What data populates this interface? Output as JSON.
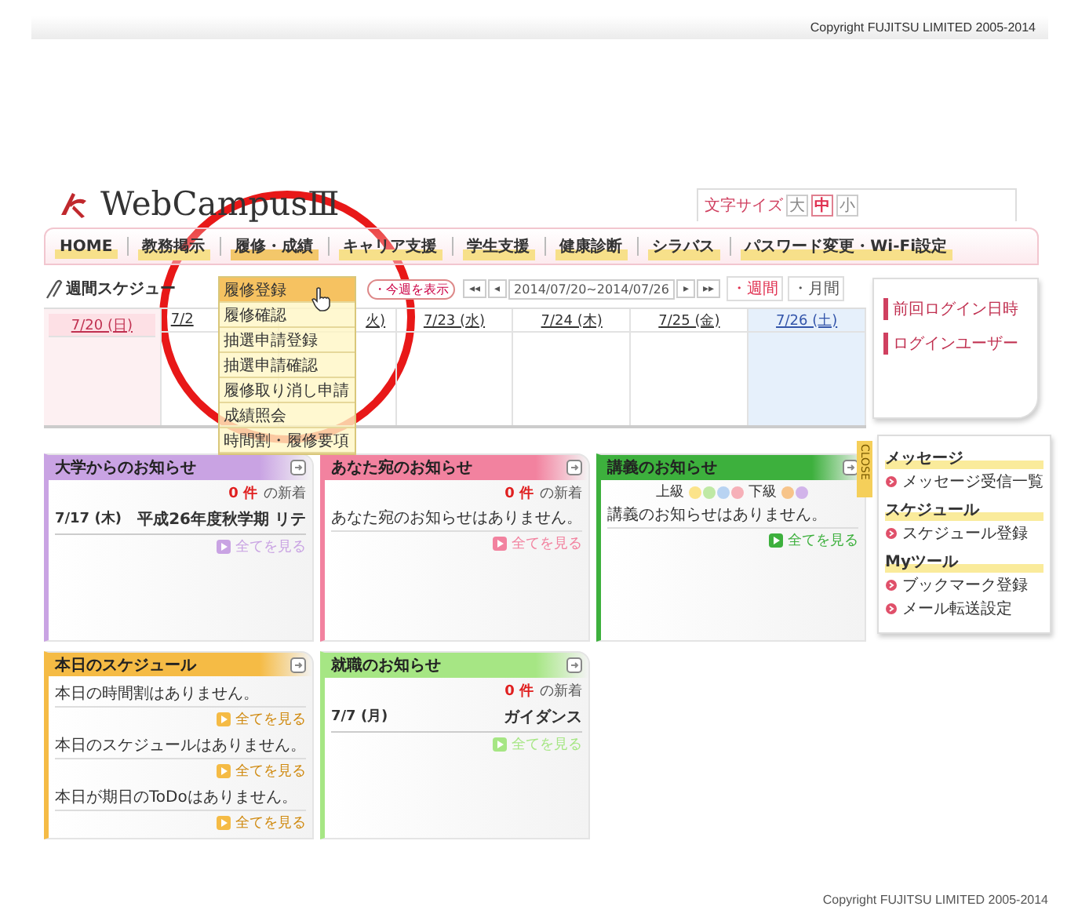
{
  "copyright_top": "Copyright FUJITSU LIMITED 2005-2014",
  "header": {
    "logo": "WebCampusⅢ",
    "font_size_label": "文字サイズ",
    "font_sizes": [
      {
        "label": "大",
        "selected": false
      },
      {
        "label": "中",
        "selected": true
      },
      {
        "label": "小",
        "selected": false
      }
    ]
  },
  "nav": [
    {
      "label": "HOME",
      "expanded": false
    },
    {
      "label": "教務掲示",
      "expanded": false
    },
    {
      "label": "履修・成績",
      "expanded": true
    },
    {
      "label": "キャリア支援",
      "expanded": false
    },
    {
      "label": "学生支援",
      "expanded": false
    },
    {
      "label": "健康診断",
      "expanded": false
    },
    {
      "label": "シラバス",
      "expanded": false
    },
    {
      "label": "パスワード変更・Wi-Fi設定",
      "expanded": false
    }
  ],
  "dropdown": [
    {
      "label": "履修登録",
      "selected": true
    },
    {
      "label": "履修確認",
      "selected": false
    },
    {
      "label": "抽選申請登録",
      "selected": false
    },
    {
      "label": "抽選申請確認",
      "selected": false
    },
    {
      "label": "履修取り消し申請",
      "selected": false
    },
    {
      "label": "成績照会",
      "selected": false
    },
    {
      "label": "時間割・履修要項",
      "selected": false
    }
  ],
  "schedule": {
    "title": "週間スケジュー",
    "today_button": "・今週を表示",
    "prev": [
      "◂◂",
      "◂"
    ],
    "range": "2014/07/20~2014/07/26",
    "next": [
      "▸",
      "▸▸"
    ],
    "views": [
      {
        "label": "・週間",
        "selected": true
      },
      {
        "label": "・月間",
        "selected": false
      }
    ],
    "days": [
      {
        "label": "7/20 (日)",
        "kind": "sunday"
      },
      {
        "label": "7/2",
        "kind": "cut_end"
      },
      {
        "label": "火)",
        "kind": "cut_start"
      },
      {
        "label": "7/23 (水)",
        "kind": "weekday"
      },
      {
        "label": "7/24 (木)",
        "kind": "weekday"
      },
      {
        "label": "7/25 (金)",
        "kind": "weekday"
      },
      {
        "label": "7/26 (土)",
        "kind": "saturday"
      }
    ]
  },
  "login_panel": [
    "前回ログイン日時",
    "ログインユーザー"
  ],
  "side_tab": "CLOSE",
  "side_menu": [
    {
      "heading": "メッセージ",
      "links": [
        "メッセージ受信一覧"
      ]
    },
    {
      "heading": "スケジュール",
      "links": [
        "スケジュール登録"
      ]
    },
    {
      "heading": "Myツール",
      "links": [
        "ブックマーク登録",
        "メール転送設定"
      ]
    }
  ],
  "cards": [
    {
      "title": "大学からのお知らせ",
      "color": "#c9a3e3",
      "items": [
        {
          "kind": "count",
          "number": "0 件",
          "label": "の新着"
        },
        {
          "kind": "news",
          "date": "7/17 (木)",
          "title": "平成26年度秋学期 リテ"
        },
        {
          "kind": "more",
          "label": "全てを見る"
        }
      ]
    },
    {
      "title": "あなた宛のお知らせ",
      "color": "#f2829f",
      "items": [
        {
          "kind": "count",
          "number": "0 件",
          "label": "の新着"
        },
        {
          "kind": "message",
          "text": "あなた宛のお知らせはありません。"
        },
        {
          "kind": "more",
          "label": "全てを見る"
        }
      ]
    },
    {
      "title": "講義のお知らせ",
      "color": "#3db03d",
      "items": [
        {
          "kind": "levels",
          "upper": "上級",
          "lower": "下級"
        },
        {
          "kind": "message",
          "text": "講義のお知らせはありません。"
        },
        {
          "kind": "more",
          "label": "全てを見る"
        }
      ]
    },
    {
      "title": "本日のスケジュール",
      "color": "#f5bb45",
      "items": [
        {
          "kind": "message",
          "text": "本日の時間割はありません。"
        },
        {
          "kind": "more",
          "label": "全てを見る"
        },
        {
          "kind": "message",
          "text": "本日のスケジュールはありません。"
        },
        {
          "kind": "more",
          "label": "全てを見る"
        },
        {
          "kind": "message",
          "text": "本日が期日のToDoはありません。"
        },
        {
          "kind": "more",
          "label": "全てを見る"
        }
      ]
    },
    {
      "title": "就職のお知らせ",
      "color": "#a6e684",
      "items": [
        {
          "kind": "count",
          "number": "0 件",
          "label": "の新着"
        },
        {
          "kind": "news",
          "date": "7/7 (月)",
          "title": "ガイダンス"
        },
        {
          "kind": "more",
          "label": "全てを見る"
        }
      ]
    }
  ],
  "copyright_bottom": "Copyright FUJITSU LIMITED 2005-2014"
}
